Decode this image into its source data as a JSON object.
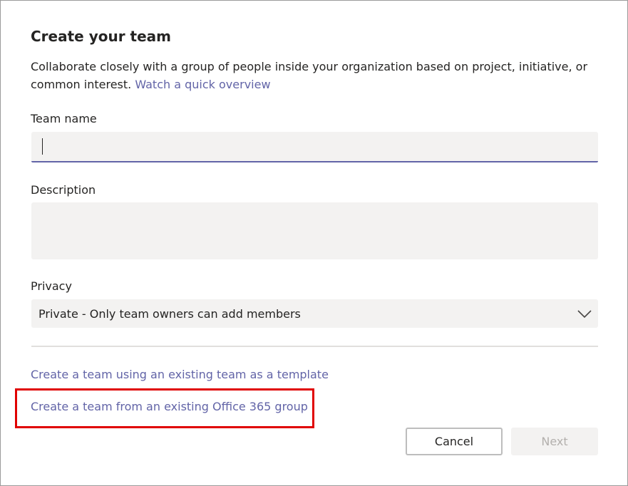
{
  "dialog": {
    "title": "Create your team",
    "description_text": "Collaborate closely with a group of people inside your organization based on project, initiative, or common interest. ",
    "overview_link": "Watch a quick overview"
  },
  "form": {
    "team_name_label": "Team name",
    "team_name_value": "",
    "description_label": "Description",
    "description_value": "",
    "privacy_label": "Privacy",
    "privacy_value": "Private - Only team owners can add members"
  },
  "options": {
    "template_link": "Create a team using an existing team as a template",
    "office365_link": "Create a team from an existing Office 365 group"
  },
  "buttons": {
    "cancel": "Cancel",
    "next": "Next"
  },
  "colors": {
    "accent": "#6264a7",
    "highlight": "#e00000",
    "field_bg": "#f3f2f1"
  },
  "icons": {
    "privacy_dropdown": "chevron-down-icon"
  }
}
